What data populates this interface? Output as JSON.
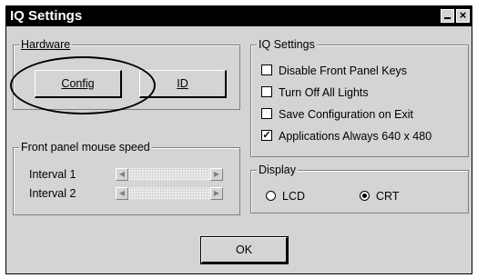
{
  "window": {
    "title": "IQ Settings",
    "minimize_glyph": "_",
    "close_glyph": "×"
  },
  "hardware": {
    "label": "Hardware",
    "config_label": "Config",
    "id_label": "ID"
  },
  "iq_settings": {
    "label": "IQ Settings",
    "options": [
      {
        "label": "Disable Front Panel Keys",
        "checked": false
      },
      {
        "label": "Turn Off All Lights",
        "checked": false
      },
      {
        "label": "Save Configuration on Exit",
        "checked": false
      },
      {
        "label": "Applications Always 640 x 480",
        "checked": true
      }
    ]
  },
  "mouse_speed": {
    "label": "Front panel mouse speed",
    "intervals": [
      {
        "label": "Interval 1"
      },
      {
        "label": "Interval 2"
      }
    ]
  },
  "display": {
    "label": "Display",
    "options": [
      {
        "label": "LCD",
        "selected": false
      },
      {
        "label": "CRT",
        "selected": true
      }
    ]
  },
  "ok_label": "OK",
  "icons": {
    "check_glyph": "✓",
    "scroll_left": "◀",
    "scroll_right": "▶"
  }
}
